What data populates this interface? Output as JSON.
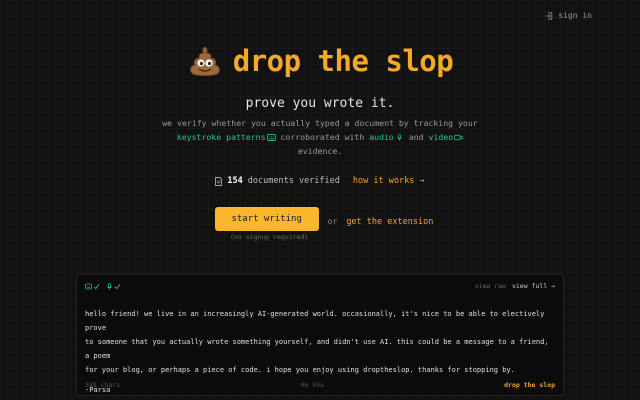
{
  "header": {
    "signin_label": "sign in"
  },
  "hero": {
    "brand": "drop the slop",
    "tagline": "prove you wrote it.",
    "desc_part1": "we verify whether you actually typed a document by tracking your",
    "desc_keystroke": "keystroke patterns",
    "desc_part2": "corroborated with",
    "desc_audio": "audio",
    "desc_and": "and",
    "desc_video": "video",
    "desc_end": "evidence."
  },
  "stats": {
    "count": "154",
    "count_label": "documents verified",
    "how_label": "how it works →"
  },
  "cta": {
    "start_label": "start writing",
    "or_label": "or",
    "extension_label": "get the extension",
    "nosignup": "(no signup required)"
  },
  "card": {
    "view_raw": "view raw",
    "view_full": "view full →",
    "body_line1": "hello friend! we live in an increasingly AI-generated world. occasionally, it's nice to be able to electively prove",
    "body_line2": "to someone that you actually wrote something yourself, and didn't use AI. this could be a message to a friend, a poem",
    "body_line3": "for your blog, or perhaps a piece of code. i hope you enjoy using droptheslop. thanks for stopping by.",
    "signature": "-Parsa",
    "chars": "348 chars",
    "duration": "0m 59s",
    "watermark": "drop the slop"
  },
  "colors": {
    "accent": "#f6a828",
    "button": "#fbb72b",
    "highlight": "#22c7a3",
    "background": "#121212"
  },
  "icons": {
    "signin": "sign-in-arrow-icon",
    "logo": "poop-emoji-icon",
    "keystroke": "keyboard-icon",
    "audio": "microphone-icon",
    "video": "video-camera-icon",
    "doc": "document-icon"
  }
}
